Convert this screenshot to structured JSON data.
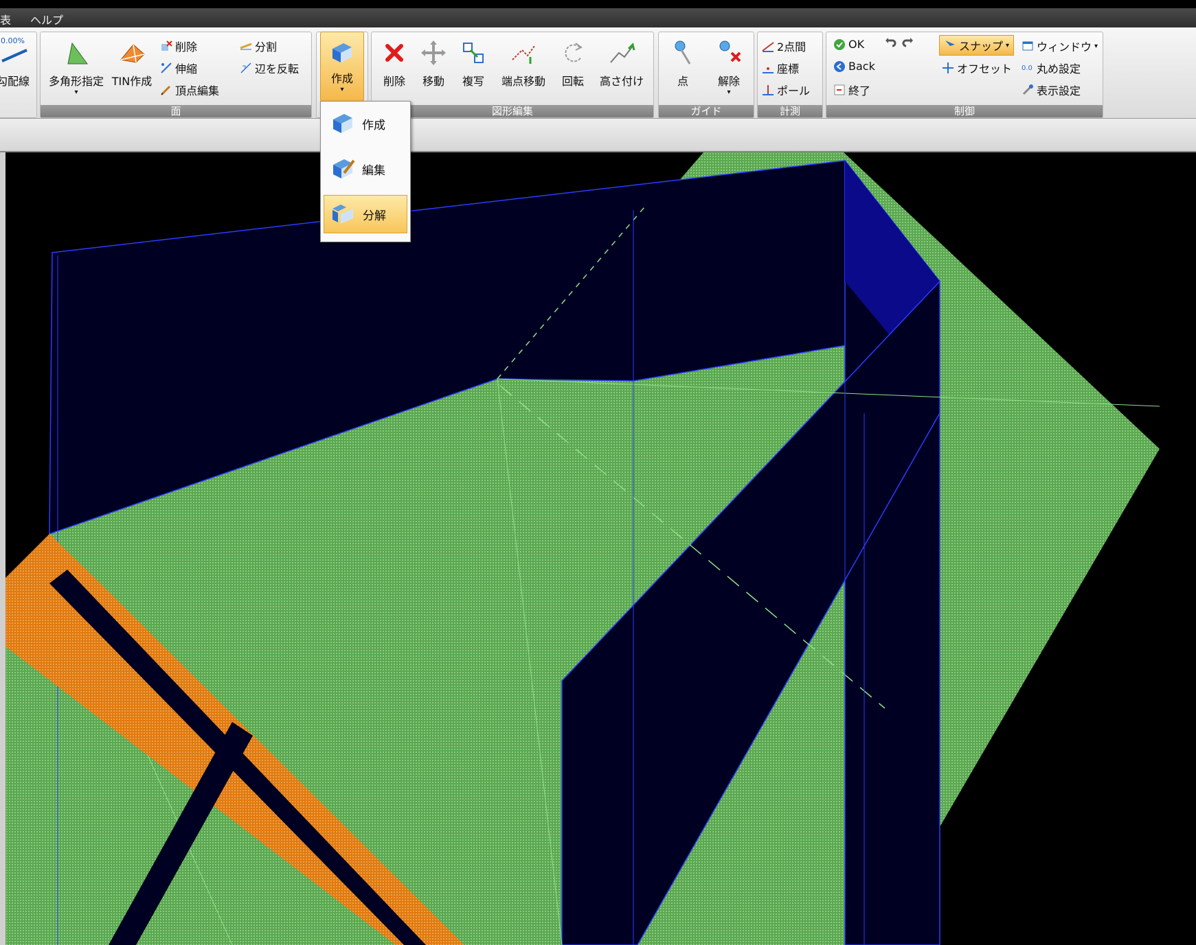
{
  "menubar": {
    "items": [
      "ヘルプ"
    ],
    "cut_item": "表"
  },
  "ribbon": {
    "groups": {
      "face": {
        "label": "面"
      },
      "edit": {
        "label": "図形編集"
      },
      "guide": {
        "label": "ガイド"
      },
      "measure": {
        "label": "計測"
      },
      "control": {
        "label": "制御"
      }
    },
    "partial_left": {
      "badge": "0.00%",
      "label": "勾配線"
    },
    "face_tools": {
      "polygon": "多角形指定",
      "tin": "TIN作成",
      "delete": "削除",
      "stretch": "伸縮",
      "vertex_edit": "頂点編集",
      "split": "分割",
      "flip_edge": "辺を反転"
    },
    "create": {
      "label": "作成"
    },
    "edit_tools": {
      "delete": "削除",
      "move": "移動",
      "copy": "複写",
      "endpoint_move": "端点移動",
      "rotate": "回転",
      "height": "高さ付け"
    },
    "guide_tools": {
      "point": "点",
      "release": "解除"
    },
    "measure_tools": {
      "two_point": "2点間",
      "coord": "座標",
      "pole": "ポール"
    },
    "control_tools": {
      "ok": "OK",
      "back": "Back",
      "end": "終了",
      "snap": "スナップ",
      "offset": "オフセット",
      "window": "ウィンドウ",
      "rounding": "丸め設定",
      "display": "表示設定"
    }
  },
  "dropdown": {
    "items": [
      "作成",
      "編集",
      "分解"
    ],
    "highlighted": "分解"
  },
  "colors": {
    "green": "#5aa84f",
    "navy": "#000022",
    "blue_line": "#2a3cff",
    "orange": "#e07a10"
  }
}
